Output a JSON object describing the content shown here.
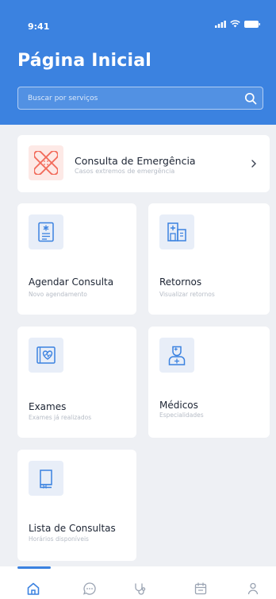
{
  "status_bar": {
    "time": "9:41"
  },
  "header": {
    "title": "Página Inicial",
    "search_placeholder": "Buscar por serviços"
  },
  "emergency": {
    "title": "Consulta de Emergência",
    "subtitle": "Casos extremos de emergência",
    "icon": "bandage-icon"
  },
  "tiles": [
    {
      "title": "Agendar Consulta",
      "subtitle": "Novo agendamento",
      "icon": "medical-document-icon"
    },
    {
      "title": "Retornos",
      "subtitle": "Visualizar retornos",
      "icon": "hospital-icon"
    },
    {
      "title": "Exames",
      "subtitle": "Exames já realizados",
      "icon": "heart-monitor-icon"
    },
    {
      "title": "Médicos",
      "subtitle": "Especialidades",
      "icon": "doctor-icon"
    },
    {
      "title": "Lista de Consultas",
      "subtitle": "Horários disponíveis",
      "icon": "book-icon"
    }
  ],
  "bottom_nav": {
    "items": [
      "home-icon",
      "chat-icon",
      "stethoscope-icon",
      "calendar-icon",
      "profile-icon"
    ],
    "active": "home-icon"
  },
  "colors": {
    "primary": "#3b82e0",
    "emergency_accent": "#f26b5b",
    "background": "#eef0f4"
  }
}
